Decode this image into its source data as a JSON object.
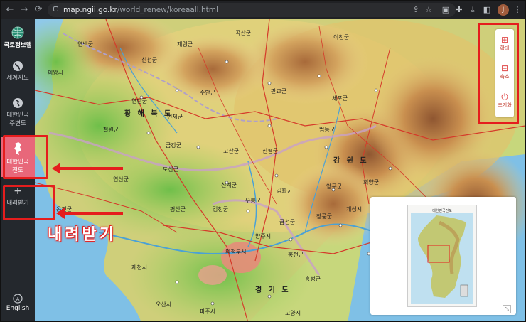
{
  "browser": {
    "url_host": "map.ngii.go.kr",
    "url_path": "/world_renew/koreaall.html",
    "profile_initial": "J"
  },
  "sidebar": {
    "items": [
      {
        "label": "국토정보맵",
        "icon": "globe-icon"
      },
      {
        "label": "세계지도",
        "icon": "world-icon"
      },
      {
        "label": "대한민국\n주변도",
        "icon": "region-icon"
      },
      {
        "label": "대한민국\n전도",
        "icon": "korea-map-icon"
      },
      {
        "label": "내려받기",
        "icon": "download-icon"
      },
      {
        "label": "English",
        "icon": "language-icon"
      }
    ]
  },
  "zoom": {
    "zoom_in": "확대",
    "zoom_out": "축소",
    "reset": "초기화"
  },
  "annotation": {
    "callout": "내려받기"
  },
  "map": {
    "regions": [
      "황 해 북 도",
      "강 원 도",
      "경 기 도"
    ],
    "places": [
      "곡산군",
      "연탄군",
      "수안군",
      "신평군",
      "판교군",
      "이천군",
      "평강군",
      "세포군",
      "법동군",
      "고산군",
      "회양군",
      "철원군",
      "김화군",
      "금강군",
      "창도군",
      "양구군",
      "인제군",
      "고성군",
      "신계군",
      "토산군",
      "연산군",
      "평산군",
      "김천군",
      "우봉군",
      "금천군",
      "장풍군",
      "판문군",
      "개성시",
      "연천군",
      "포천시",
      "가평군",
      "춘천시",
      "홍천군",
      "화천군",
      "양양군",
      "강릉시",
      "양평군",
      "횡성군",
      "평창군",
      "홍성군",
      "파주시",
      "고양시",
      "남양주시",
      "구리시",
      "하남시",
      "광주시",
      "성남시",
      "용인시",
      "여주시",
      "이천시",
      "원주시",
      "영월군",
      "정선군",
      "삼척시",
      "동해시",
      "태백시",
      "인천광역시",
      "수원시",
      "안성시",
      "평택시",
      "충주시",
      "제천시",
      "단양군",
      "서울특별시",
      "의정부시",
      "양주시",
      "동두천시",
      "강화군",
      "옹진군",
      "김포시",
      "부천시",
      "안산시",
      "시흥시",
      "화성시",
      "오산시",
      "안양시",
      "과천시",
      "군포시",
      "의왕시",
      "연백군",
      "배천군",
      "청단군",
      "강령군",
      "옹진군",
      "태탄군",
      "신천군",
      "재령군",
      "안악군",
      "은율군",
      "은천군",
      "송림시",
      "황주군",
      "봉산군",
      "서흥군",
      "린산군",
      "사리원시",
      "장연군",
      "룡연군",
      "삼천군",
      "벽성군",
      "해주시",
      "평산군",
      "장풍군",
      "통천군",
      "안변군",
      "천내군",
      "인제군",
      "고성군",
      "속초시",
      "문주군",
      "은천군",
      "은율군",
      "과일군",
      "송화군",
      "내려받기"
    ],
    "minimap_title": "대한민국전도"
  }
}
